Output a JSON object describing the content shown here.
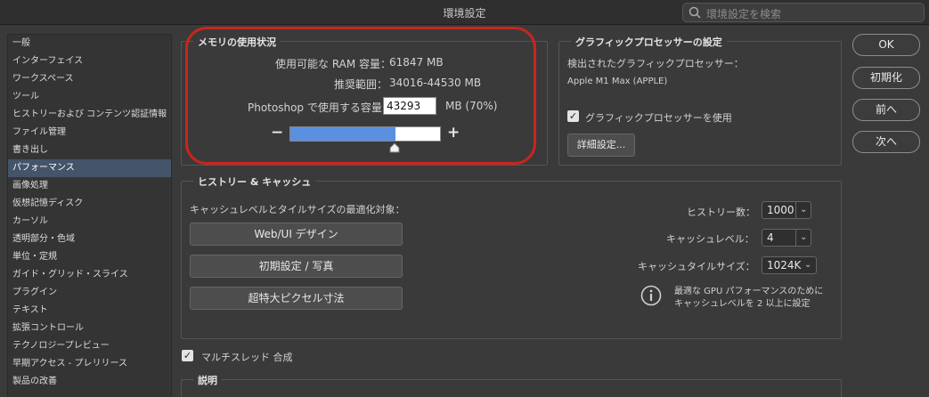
{
  "window": {
    "title": "環境設定",
    "search_placeholder": "環境設定を検索"
  },
  "sidebar": {
    "items": [
      {
        "label": "一般",
        "selected": false
      },
      {
        "label": "インターフェイス",
        "selected": false
      },
      {
        "label": "ワークスペース",
        "selected": false
      },
      {
        "label": "ツール",
        "selected": false
      },
      {
        "label": "ヒストリーおよび コンテンツ認証情報",
        "selected": false
      },
      {
        "label": "ファイル管理",
        "selected": false
      },
      {
        "label": "書き出し",
        "selected": false
      },
      {
        "label": "パフォーマンス",
        "selected": true
      },
      {
        "label": "画像処理",
        "selected": false
      },
      {
        "label": "仮想記憶ディスク",
        "selected": false
      },
      {
        "label": "カーソル",
        "selected": false
      },
      {
        "label": "透明部分・色域",
        "selected": false
      },
      {
        "label": "単位・定規",
        "selected": false
      },
      {
        "label": "ガイド・グリッド・スライス",
        "selected": false
      },
      {
        "label": "プラグイン",
        "selected": false
      },
      {
        "label": "テキスト",
        "selected": false
      },
      {
        "label": "拡張コントロール",
        "selected": false
      },
      {
        "label": "テクノロジープレビュー",
        "selected": false
      },
      {
        "label": "早期アクセス - プレリリース",
        "selected": false
      },
      {
        "label": "製品の改善",
        "selected": false
      }
    ]
  },
  "memory": {
    "legend": "メモリの使用状況",
    "available_label": "使用可能な RAM 容量：",
    "available_value": "61847 MB",
    "range_label": "推奨範囲：",
    "range_value": "34016-44530 MB",
    "use_label": "Photoshop で使用する容量：",
    "use_value": "43293",
    "use_unit": "MB (70%)",
    "slider_fraction": 0.7,
    "minus": "−",
    "plus": "+"
  },
  "gpu": {
    "legend": "グラフィックプロセッサーの設定",
    "detected_label": "検出されたグラフィックプロセッサー：",
    "detected_value": "Apple M1 Max (APPLE)",
    "use_gpu_label": "グラフィックプロセッサーを使用",
    "use_gpu_checked": true,
    "advanced_button": "詳細設定..."
  },
  "history_cache": {
    "legend": "ヒストリー & キャッシュ",
    "optimize_label": "キャッシュレベルとタイルサイズの最適化対象：",
    "buttons": [
      "Web/UI デザイン",
      "初期設定 / 写真",
      "超特大ピクセル寸法"
    ],
    "history_states_label": "ヒストリー数：",
    "history_states_value": "1000",
    "cache_levels_label": "キャッシュレベル：",
    "cache_levels_value": "4",
    "tile_size_label": "キャッシュタイルサイズ：",
    "tile_size_value": "1024K",
    "note_line1": "最適な GPU パフォーマンスのために",
    "note_line2": "キャッシュレベルを 2 以上に設定"
  },
  "multithread": {
    "label": "マルチスレッド 合成",
    "checked": true
  },
  "description": {
    "legend": "説明"
  },
  "actions": {
    "ok": "OK",
    "reset": "初期化",
    "prev": "前へ",
    "next": "次へ"
  },
  "colors": {
    "accent_highlight": "#c8251e",
    "slider_fill": "#5b8fe0",
    "selected_row": "#44546a"
  }
}
